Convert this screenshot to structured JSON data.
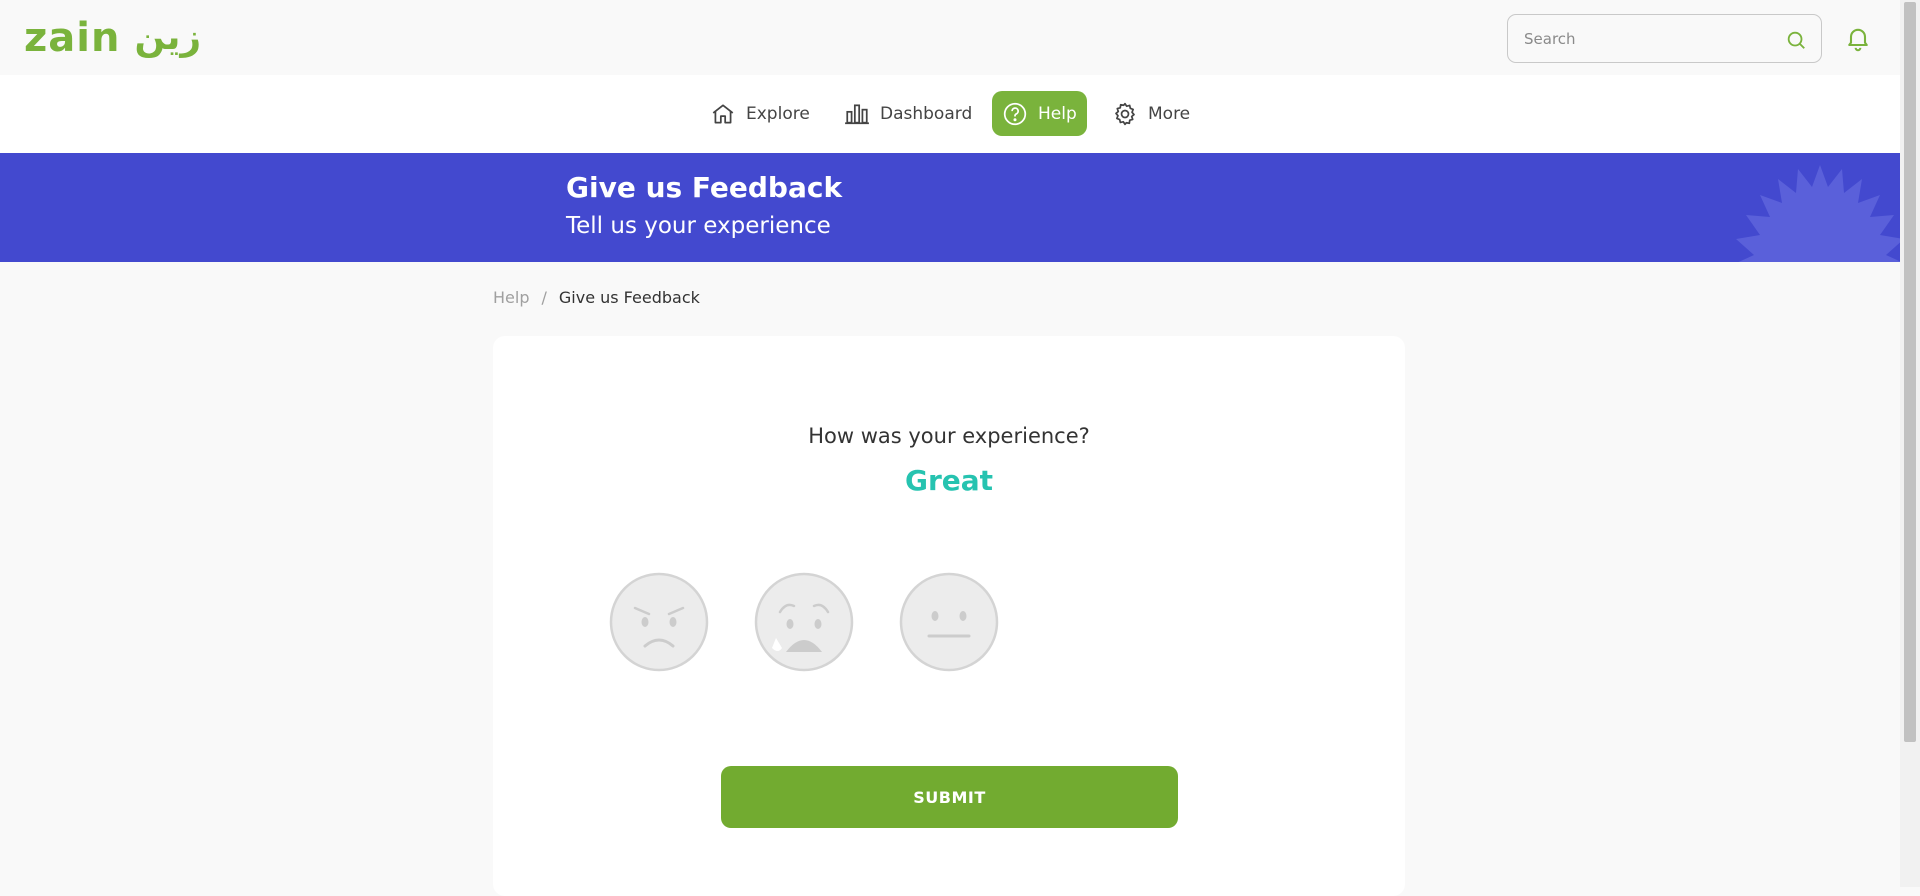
{
  "brand": {
    "logo_text": "zain",
    "logo_arabic": "زين",
    "accent_color": "#7ab33c"
  },
  "header": {
    "search_placeholder": "Search",
    "search_icon": "search-icon",
    "notification_icon": "bell-icon"
  },
  "nav": {
    "items": [
      {
        "label": "Explore",
        "icon": "home-icon"
      },
      {
        "label": "Dashboard",
        "icon": "bar-chart-icon"
      },
      {
        "label": "Help",
        "icon": "help-circle-icon",
        "active": true
      },
      {
        "label": "More",
        "icon": "gear-icon"
      }
    ]
  },
  "banner": {
    "title": "Give us Feedback",
    "subtitle": "Tell us your experience",
    "color": "#4349cf"
  },
  "breadcrumb": {
    "parent": "Help",
    "separator": "/",
    "current": "Give us Feedback"
  },
  "feedback": {
    "question": "How was your experience?",
    "selected_label": "Great",
    "selected_color": "#26c3b0",
    "faces": [
      {
        "name": "angry-face-icon"
      },
      {
        "name": "crying-face-icon"
      },
      {
        "name": "neutral-face-icon"
      }
    ],
    "submit_label": "SUBMIT"
  }
}
